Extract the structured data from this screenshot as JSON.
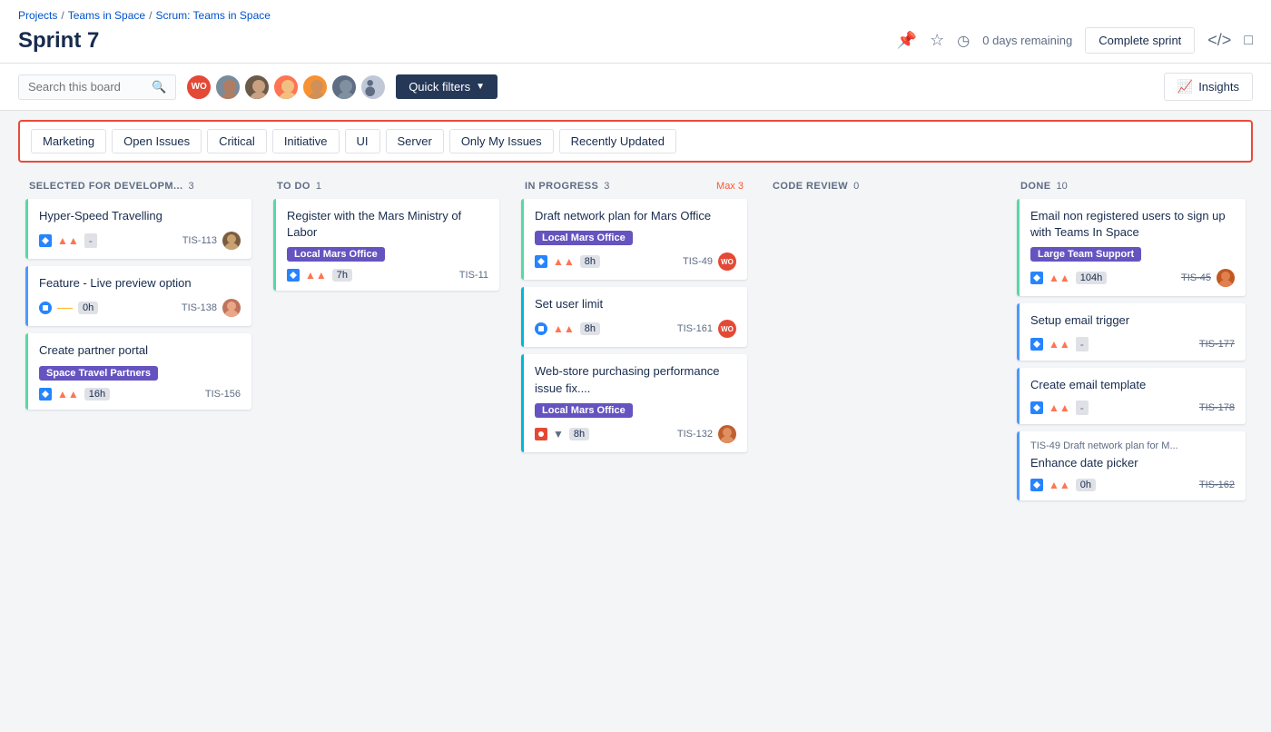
{
  "breadcrumb": {
    "parts": [
      "Projects",
      "Teams in Space",
      "Scrum: Teams in Space"
    ]
  },
  "page": {
    "title": "Sprint 7",
    "days_remaining": "0 days remaining",
    "complete_sprint": "Complete sprint"
  },
  "toolbar": {
    "search_placeholder": "Search this board",
    "quick_filters_label": "Quick filters",
    "insights_label": "Insights"
  },
  "filters": [
    "Marketing",
    "Open Issues",
    "Critical",
    "Initiative",
    "UI",
    "Server",
    "Only My Issues",
    "Recently Updated"
  ],
  "columns": [
    {
      "id": "selected",
      "title": "SELECTED FOR DEVELOPM...",
      "count": "3",
      "cards": [
        {
          "title": "Hyper-Speed Travelling",
          "border": "green",
          "icons": [
            "story",
            "priority-high",
            "minus"
          ],
          "id": "TIS-113",
          "has_avatar": true,
          "avatar_type": "brown"
        },
        {
          "title": "Feature - Live preview option",
          "border": "blue",
          "icons": [
            "task",
            "medium",
            "minus"
          ],
          "time": "0h",
          "id": "TIS-138",
          "has_avatar": true,
          "avatar_type": "brown2"
        },
        {
          "title": "Create partner portal",
          "label": "Space Travel Partners",
          "label_class": "label-space-travel",
          "border": "green",
          "icons": [
            "story",
            "priority-high"
          ],
          "time": "16h",
          "id": "TIS-156"
        }
      ]
    },
    {
      "id": "todo",
      "title": "TO DO",
      "count": "1",
      "cards": [
        {
          "title": "Register with the Mars Ministry of Labor",
          "label": "Local Mars Office",
          "label_class": "label-mars",
          "border": "green",
          "icons": [
            "story",
            "priority-high"
          ],
          "time": "7h",
          "id": "TIS-11"
        }
      ]
    },
    {
      "id": "inprogress",
      "title": "IN PROGRESS",
      "count": "3",
      "max": "Max 3",
      "cards": [
        {
          "title": "Draft network plan for Mars Office",
          "label": "Local Mars Office",
          "label_class": "label-mars",
          "border": "green",
          "icons": [
            "story",
            "priority-high"
          ],
          "time": "8h",
          "id": "TIS-49",
          "has_avatar": true,
          "avatar_type": "wo"
        },
        {
          "title": "Set user limit",
          "border": "teal",
          "icons": [
            "task",
            "priority-high"
          ],
          "time": "8h",
          "id": "TIS-161",
          "has_avatar": true,
          "avatar_type": "wo"
        },
        {
          "title": "Web-store purchasing performance issue fix....",
          "label": "Local Mars Office",
          "label_class": "label-mars",
          "border": "teal",
          "icons": [
            "bug",
            "chevron-down"
          ],
          "time": "8h",
          "id": "TIS-132",
          "has_avatar": true,
          "avatar_type": "orange"
        }
      ]
    },
    {
      "id": "codereview",
      "title": "CODE REVIEW",
      "count": "0",
      "cards": []
    },
    {
      "id": "done",
      "title": "DONE",
      "count": "10",
      "cards": [
        {
          "title": "Email non registered users to sign up with Teams In Space",
          "label": "Large Team Support",
          "label_class": "label-large-team",
          "border": "green",
          "icons": [
            "story",
            "priority-high"
          ],
          "time": "104h",
          "id": "TIS-45",
          "id_strikethrough": true,
          "has_avatar": true,
          "avatar_type": "orange2"
        },
        {
          "title": "Setup email trigger",
          "border": "blue",
          "icons": [
            "story",
            "priority-high",
            "minus"
          ],
          "id": "TIS-177",
          "id_strikethrough": true
        },
        {
          "title": "Create email template",
          "border": "blue",
          "icons": [
            "story",
            "priority-high",
            "minus"
          ],
          "id": "TIS-178",
          "id_strikethrough": true
        },
        {
          "ref_text": "TIS-49 Draft network plan for M...",
          "title": "Enhance date picker",
          "border": "blue",
          "icons": [
            "story",
            "priority-high"
          ],
          "time": "0h",
          "id": "TIS-162",
          "id_strikethrough": true
        }
      ]
    }
  ]
}
